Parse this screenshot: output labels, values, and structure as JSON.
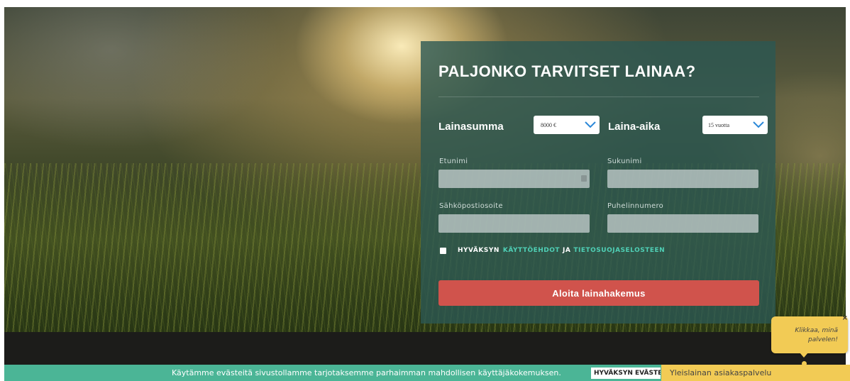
{
  "form": {
    "title": "PALJONKO TARVITSET LAINAA?",
    "loan_amount_label": "Lainasumma",
    "loan_amount_value": "8000 €",
    "loan_term_label": "Laina-aika",
    "loan_term_value": "15 vuotta",
    "first_name_label": "Etunimi",
    "last_name_label": "Sukunimi",
    "email_label": "Sähköpostiosoite",
    "phone_label": "Puhelinnumero",
    "consent_prefix": "HYVÄKSYN",
    "consent_link1": "KÄYTTÖEHDOT",
    "consent_and": "JA",
    "consent_link2": "TIETOSUOJASELOSTEEN",
    "submit_label": "Aloita lainahakemus"
  },
  "cookie": {
    "message": "Käytämme evästeitä sivustollamme tarjotaksemme parhaimman mahdollisen käyttäjäkokemuksen.",
    "accept_label": "HYVÄKSYN EVÄSTEET"
  },
  "chat": {
    "bubble_line1": "Klikkaa, minä",
    "bubble_line2": "palvelen!",
    "close_symbol": "×",
    "tab_label": "Yleislainan asiakaspalvelu"
  },
  "colors": {
    "panel": "#2c5852",
    "cta": "#d0534c",
    "cookie_bar": "#4bb596",
    "chat": "#f2cb55",
    "link": "#4fd0b6"
  },
  "icons": [
    "chevron-down-icon",
    "checkbox-icon",
    "close-icon"
  ]
}
